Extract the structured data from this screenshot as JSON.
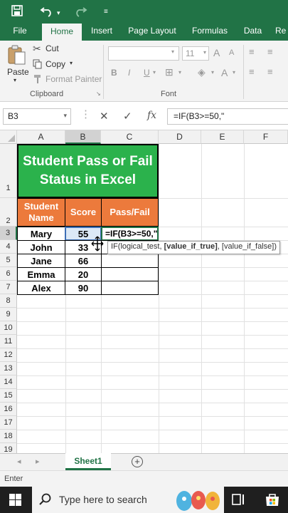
{
  "quick_access": {
    "save_icon": "save-icon",
    "undo_icon": "undo-icon",
    "redo_icon": "redo-icon",
    "customize_icon": "customize-icon"
  },
  "tabs": [
    {
      "label": "File"
    },
    {
      "label": "Home"
    },
    {
      "label": "Insert"
    },
    {
      "label": "Page Layout"
    },
    {
      "label": "Formulas"
    },
    {
      "label": "Data"
    },
    {
      "label": "Re"
    }
  ],
  "clipboard": {
    "paste": "Paste",
    "cut": "Cut",
    "copy": "Copy",
    "format_painter": "Format Painter",
    "group_label": "Clipboard"
  },
  "font": {
    "size": "11",
    "bold": "B",
    "italic": "I",
    "underline": "U",
    "grow": "A",
    "shrink": "A",
    "color": "A",
    "group_label": "Font"
  },
  "formula_bar": {
    "name_box": "B3",
    "cancel": "✕",
    "enter": "✓",
    "fx": "fx",
    "formula": "=IF(B3>=50,\""
  },
  "columns": [
    "A",
    "B",
    "C",
    "D",
    "E",
    "F"
  ],
  "rows": [
    "1",
    "2",
    "3",
    "4",
    "5",
    "6",
    "7",
    "8",
    "9",
    "10",
    "11",
    "12",
    "13",
    "14",
    "15",
    "16",
    "17",
    "18",
    "19"
  ],
  "sheet": {
    "title_line1": "Student Pass or Fail",
    "title_line2": "Status in Excel",
    "headers": {
      "name_line1": "Student",
      "name_line2": "Name",
      "score": "Score",
      "status": "Pass/Fail"
    },
    "students": [
      {
        "name": "Mary",
        "score": "55"
      },
      {
        "name": "John",
        "score": "33"
      },
      {
        "name": "Jane",
        "score": "66"
      },
      {
        "name": "Emma",
        "score": "20"
      },
      {
        "name": "Alex",
        "score": "90"
      }
    ],
    "editing_cell": "=IF(B3>=50,\""
  },
  "tooltip": {
    "func": "IF(logical_test, ",
    "arg2": "[value_if_true]",
    "sep": ", ",
    "arg3": "[value_if_false]",
    "close": ")"
  },
  "sheet_tabs": {
    "active": "Sheet1",
    "add": "+"
  },
  "status_bar": {
    "mode": "Enter"
  },
  "taskbar": {
    "search_placeholder": "Type here to search"
  },
  "colors": {
    "excel_green": "#217346",
    "title_green": "#2bb24c",
    "header_orange": "#ec7a3c"
  }
}
